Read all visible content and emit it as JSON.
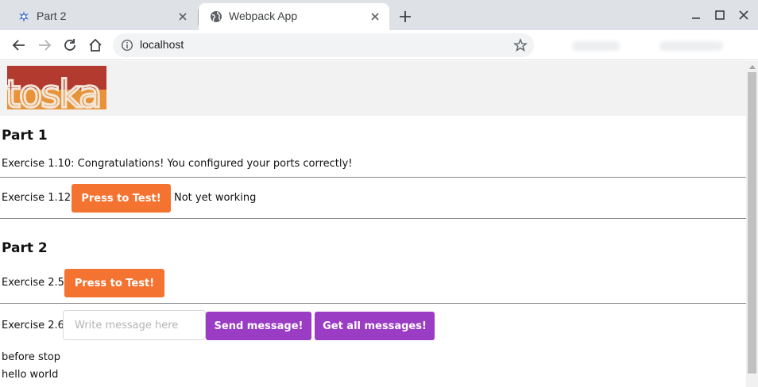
{
  "browser": {
    "tabs": [
      {
        "title": "Part 2",
        "active": false,
        "favicon": "bug-star-icon"
      },
      {
        "title": "Webpack App",
        "active": true,
        "favicon": "globe-icon"
      }
    ],
    "url": "localhost"
  },
  "page": {
    "logo_text": "toska",
    "part1": {
      "heading": "Part 1",
      "ex110": "Exercise 1.10: Congratulations! You configured your ports correctly!",
      "ex112_label": "Exercise 1.12:",
      "ex112_button": "Press to Test!",
      "ex112_status": "Not yet working"
    },
    "part2": {
      "heading": "Part 2",
      "ex25_label": "Exercise 2.5:",
      "ex25_button": "Press to Test!",
      "ex26_label": "Exercise 2.6:",
      "message_placeholder": "Write message here",
      "send_button": "Send message!",
      "get_button": "Get all messages!",
      "messages": [
        "before stop",
        "hello world"
      ]
    }
  },
  "colors": {
    "orange": "#f47330",
    "purple": "#9b3cc4",
    "logo_red": "#b23a2f",
    "logo_orange": "#e8923a"
  }
}
